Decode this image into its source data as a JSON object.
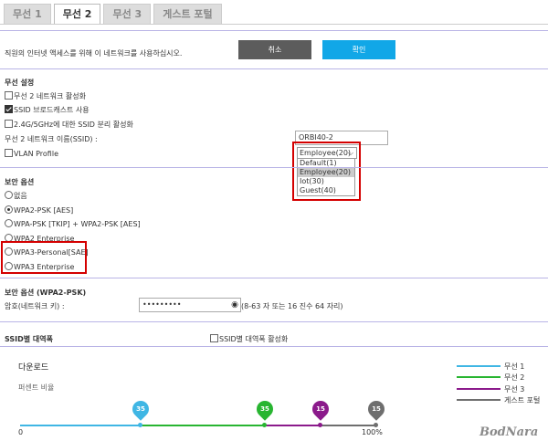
{
  "tabs": [
    "무선 1",
    "무선 2",
    "무선 3",
    "게스트 포털"
  ],
  "header": {
    "message": "직원의 인터넷 액세스를 위해 이 네트워크를 사용하십시오.",
    "cancel": "취소",
    "confirm": "확인"
  },
  "wireless": {
    "title": "무선 설정",
    "enable_label": "무선 2 네트워크 활성화",
    "broadcast_label": "SSID 브로드캐스트 사용",
    "separate_label": "2.4G/5GHz에 대한 SSID 분리 활성화",
    "ssid_label": "무선 2 네트워크 이름(SSID) :",
    "ssid_value": "ORBI40-2",
    "vlan_label": "VLAN Profile",
    "vlan_selected": "Employee(20)",
    "vlan_options": [
      "Default(1)",
      "Employee(20)",
      "Iot(30)",
      "Guest(40)"
    ]
  },
  "security": {
    "title": "보안 옵션",
    "options": [
      "없음",
      "WPA2-PSK [AES]",
      "WPA-PSK [TKIP] + WPA2-PSK [AES]",
      "WPA2 Enterprise",
      "WPA3-Personal[SAE]",
      "WPA3 Enterprise"
    ]
  },
  "security_psk": {
    "title": "보안 옵션 (WPA2-PSK)",
    "password_label": "암호(네트워크 키) :",
    "password_value": "•••••••••",
    "hint": "(8-63 자 또는 16 진수 64 자리)"
  },
  "bandwidth": {
    "title": "SSID별 대역폭",
    "enable_label": "SSID별 대역폭 활성화",
    "download": "다운로드",
    "percent_label": "퍼센트 비율",
    "axis_start": "0",
    "axis_end": "100%",
    "pins": [
      {
        "name": "무선 1",
        "value": "35",
        "color": "#3fb6e4"
      },
      {
        "name": "무선 2",
        "value": "35",
        "color": "#28b531"
      },
      {
        "name": "무선 3",
        "value": "15",
        "color": "#8b1a8b"
      },
      {
        "name": "게스트 포털",
        "value": "15",
        "color": "#6e6e6e"
      }
    ],
    "legend": [
      "무선 1",
      "무선 2",
      "무선 3",
      "게스트 포털"
    ]
  },
  "watermark": "BodNara",
  "colors": {
    "cancel": "#5c5c5c",
    "confirm": "#11a7e7",
    "highlight": "#d40000",
    "divider": "#b9b4e6"
  }
}
